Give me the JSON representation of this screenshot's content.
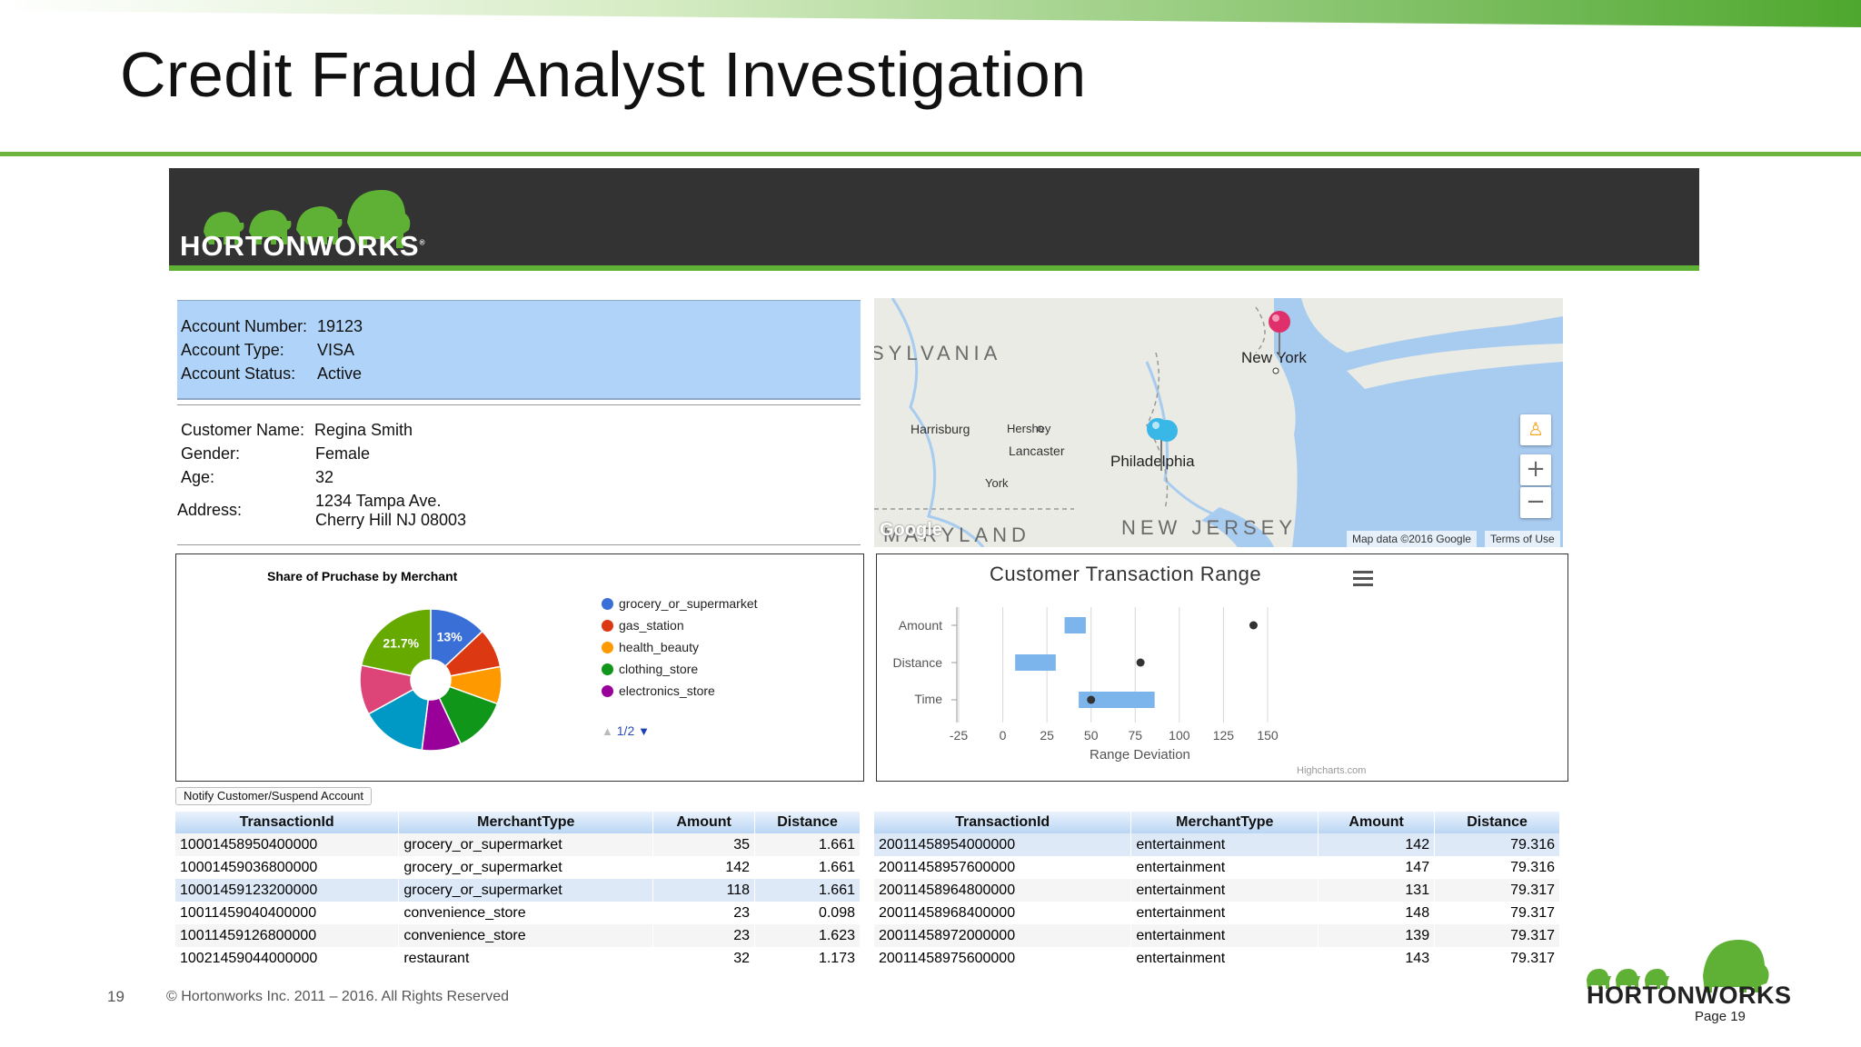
{
  "slide": {
    "title": "Credit Fraud Analyst Investigation",
    "page_number": "19",
    "copyright": "© Hortonworks Inc. 2011 – 2016. All Rights Reserved",
    "footer_brand": "HORTONWORKS",
    "footer_page_label": "Page 19"
  },
  "app": {
    "brand": "HORTONWORKS",
    "colors": {
      "header_bg": "#333333",
      "accent_green": "#5fb136",
      "account_panel": "#b0d4f9"
    }
  },
  "account": {
    "number_label": "Account Number:",
    "number": "19123",
    "type_label": "Account Type:",
    "type": "VISA",
    "status_label": "Account Status:",
    "status": "Active"
  },
  "customer": {
    "name_label": "Customer Name:",
    "name": "Regina Smith",
    "gender_label": "Gender:",
    "gender": "Female",
    "age_label": "Age:",
    "age": "32",
    "address_label": "Address:",
    "address_line1": "1234 Tampa Ave.",
    "address_line2": "Cherry Hill NJ 08003"
  },
  "map": {
    "labels": {
      "region_pa": "SYLVANIA",
      "region_md": "MARYLAND",
      "region_nj": "NEW JERSEY",
      "new_york": "New York",
      "harrisburg": "Harrisburg",
      "hershey": "Hershey",
      "lancaster": "Lancaster",
      "york": "York",
      "philadelphia": "Philadelphia"
    },
    "google": "Google",
    "attribution": "Map data ©2016 Google",
    "terms": "Terms of Use",
    "zoom_in": "+",
    "zoom_out": "−"
  },
  "pie_chart": {
    "title": "Share of Pruchase by Merchant",
    "legend": [
      {
        "name": "grocery_or_supermarket",
        "color": "#3a6fd8"
      },
      {
        "name": "gas_station",
        "color": "#dc3912"
      },
      {
        "name": "health_beauty",
        "color": "#ff9900"
      },
      {
        "name": "clothing_store",
        "color": "#109618"
      },
      {
        "name": "electronics_store",
        "color": "#990099"
      }
    ],
    "pager": "1/2"
  },
  "range_chart": {
    "title": "Customer Transaction Range",
    "x_axis_title": "Range Deviation",
    "credits": "Highcharts.com"
  },
  "chart_data": [
    {
      "type": "pie",
      "title": "Share of Pruchase by Merchant",
      "categories": [
        "grocery_or_supermarket",
        "gas_station",
        "health_beauty",
        "clothing_store",
        "electronics_store",
        "",
        "",
        ""
      ],
      "values": [
        13.0,
        9.0,
        8.5,
        12.5,
        9.0,
        15.0,
        11.3,
        21.7
      ],
      "colors": [
        "#3a6fd8",
        "#dc3912",
        "#ff9900",
        "#109618",
        "#990099",
        "#0099c6",
        "#dd4477",
        "#66aa00"
      ],
      "slice_labels": [
        "13%",
        "",
        "",
        "",
        "",
        "",
        "",
        "21.7%"
      ],
      "donut": true
    },
    {
      "type": "bar",
      "title": "Customer Transaction Range",
      "categories": [
        "Amount",
        "Distance",
        "Time"
      ],
      "ranges": [
        [
          35,
          47
        ],
        [
          7,
          30
        ],
        [
          43,
          86
        ]
      ],
      "points": [
        142,
        78,
        50
      ],
      "xlabel": "Range Deviation",
      "xlim": [
        -25,
        150
      ],
      "xticks": [
        -25,
        0,
        25,
        50,
        75,
        100,
        125,
        150
      ],
      "grid": true,
      "orientation": "horizontal"
    }
  ],
  "actions": {
    "notify": "Notify Customer/Suspend Account"
  },
  "table_left": {
    "columns": [
      "TransactionId",
      "MerchantType",
      "Amount",
      "Distance"
    ],
    "rows": [
      [
        "10001458950400000",
        "grocery_or_supermarket",
        "35",
        "1.661"
      ],
      [
        "10001459036800000",
        "grocery_or_supermarket",
        "142",
        "1.661"
      ],
      [
        "10001459123200000",
        "grocery_or_supermarket",
        "118",
        "1.661"
      ],
      [
        "10011459040400000",
        "convenience_store",
        "23",
        "0.098"
      ],
      [
        "10011459126800000",
        "convenience_store",
        "23",
        "1.623"
      ],
      [
        "10021459044000000",
        "restaurant",
        "32",
        "1.173"
      ]
    ]
  },
  "table_right": {
    "columns": [
      "TransactionId",
      "MerchantType",
      "Amount",
      "Distance"
    ],
    "rows": [
      [
        "20011458954000000",
        "entertainment",
        "142",
        "79.316"
      ],
      [
        "20011458957600000",
        "entertainment",
        "147",
        "79.316"
      ],
      [
        "20011458964800000",
        "entertainment",
        "131",
        "79.317"
      ],
      [
        "20011458968400000",
        "entertainment",
        "148",
        "79.317"
      ],
      [
        "20011458972000000",
        "entertainment",
        "139",
        "79.317"
      ],
      [
        "20011458975600000",
        "entertainment",
        "143",
        "79.317"
      ]
    ]
  }
}
